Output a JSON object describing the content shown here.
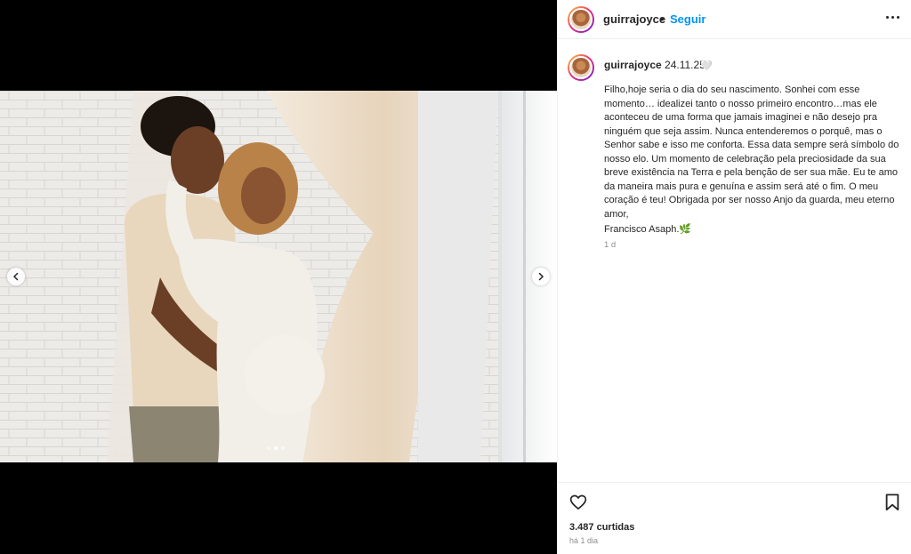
{
  "post": {
    "username": "guirrajoyce",
    "separator": "•",
    "follow_label": "Seguir",
    "caption_username": "guirrajoyce",
    "caption_date": "24.11.25",
    "caption_heart": "🤍",
    "caption_text": "Filho,hoje seria o dia do seu nascimento. Sonhei com esse momento… idealizei tanto o nosso primeiro encontro…mas ele aconteceu de uma forma que jamais imaginei e não desejo pra ninguém que seja assim. Nunca entenderemos o porquê, mas o Senhor sabe e isso me conforta. Essa data sempre será símbolo do nosso elo. Um momento de celebração pela preciosidade da sua breve existência na Terra e pela benção de ser sua mãe. Eu te amo da maneira mais pura e genuína e assim será até o fim. O meu coração é teu! Obrigada por ser nosso Anjo da guarda, meu eterno amor,",
    "signature": "Francisco Asaph.🌿",
    "caption_time": "1 d",
    "likes": "3.487 curtidas",
    "posted_ago": "há 1 dia"
  },
  "carousel": {
    "slide_count": 3,
    "active_index": 1
  },
  "icons": {
    "prev": "chevron-left-icon",
    "next": "chevron-right-icon",
    "more": "more-horizontal-icon",
    "like": "heart-outline-icon",
    "save": "bookmark-outline-icon"
  },
  "colors": {
    "follow": "#0095f6",
    "muted": "#8e8e8e",
    "text": "#262626"
  }
}
